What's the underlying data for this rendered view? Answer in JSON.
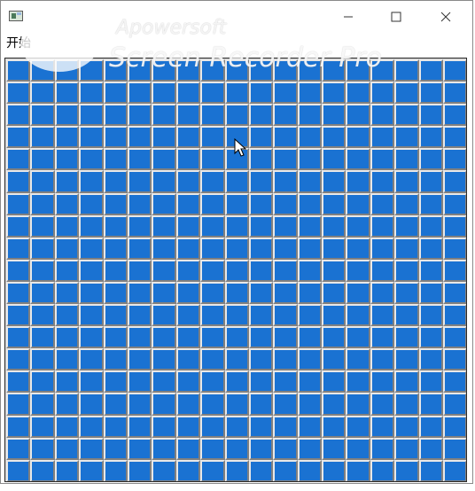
{
  "window": {
    "menu": {
      "start_label": "开始"
    },
    "controls": {
      "minimize": "minimize",
      "maximize": "maximize",
      "close": "close"
    }
  },
  "watermark": {
    "line1": "Apowersoft",
    "line2": "Screen Recorder Pro"
  },
  "board": {
    "columns": 19,
    "rows": 19,
    "cell_state": "covered",
    "cell_color": "#1a72d2"
  },
  "icons": {
    "app": "app-icon",
    "minimize": "minimize-icon",
    "maximize": "maximize-icon",
    "close": "close-icon",
    "cursor": "mouse-cursor-icon"
  }
}
